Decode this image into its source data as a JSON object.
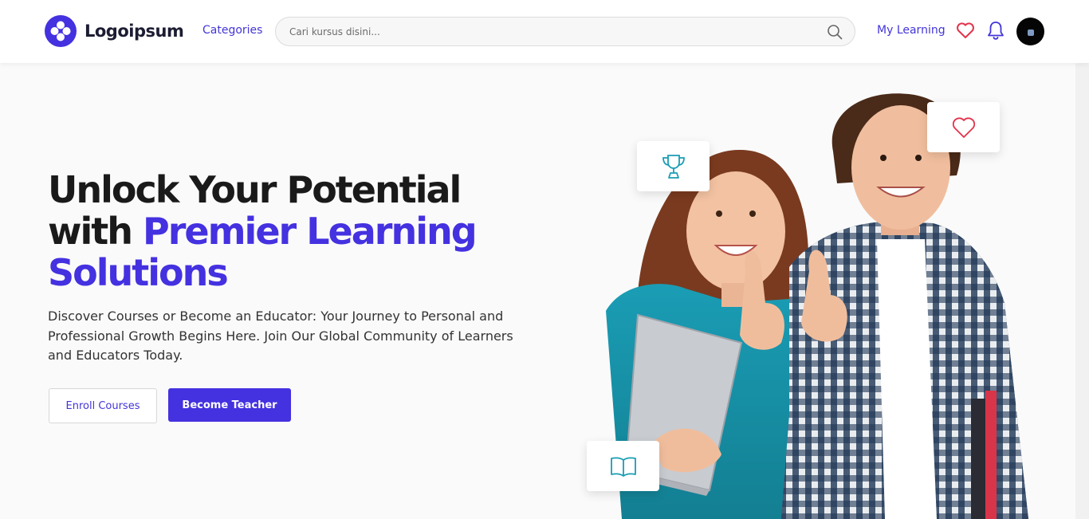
{
  "header": {
    "logo_text": "Logoipsum",
    "categories_label": "Categories",
    "search": {
      "placeholder": "Cari kursus disini..."
    },
    "my_learning_label": "My Learning",
    "icons": [
      "heart-icon",
      "bell-icon",
      "search-icon"
    ]
  },
  "hero": {
    "title_line1": "Unlock Your Potential",
    "title_with": "with ",
    "title_accent_line2": "Premier Learning",
    "title_accent_line3": "Solutions",
    "description": "Discover Courses or Become an Educator: Your Journey to Personal and Professional Growth Begins Here. Join Our Global Community of Learners and Educators Today.",
    "enroll_label": "Enroll Courses",
    "teacher_label": "Become Teacher"
  },
  "floating_cards": {
    "icons": [
      "trophy-icon",
      "heart-icon",
      "book-icon"
    ]
  },
  "colors": {
    "brand": "#4431e0",
    "heart": "#e2344c",
    "teal": "#1a9db5"
  }
}
